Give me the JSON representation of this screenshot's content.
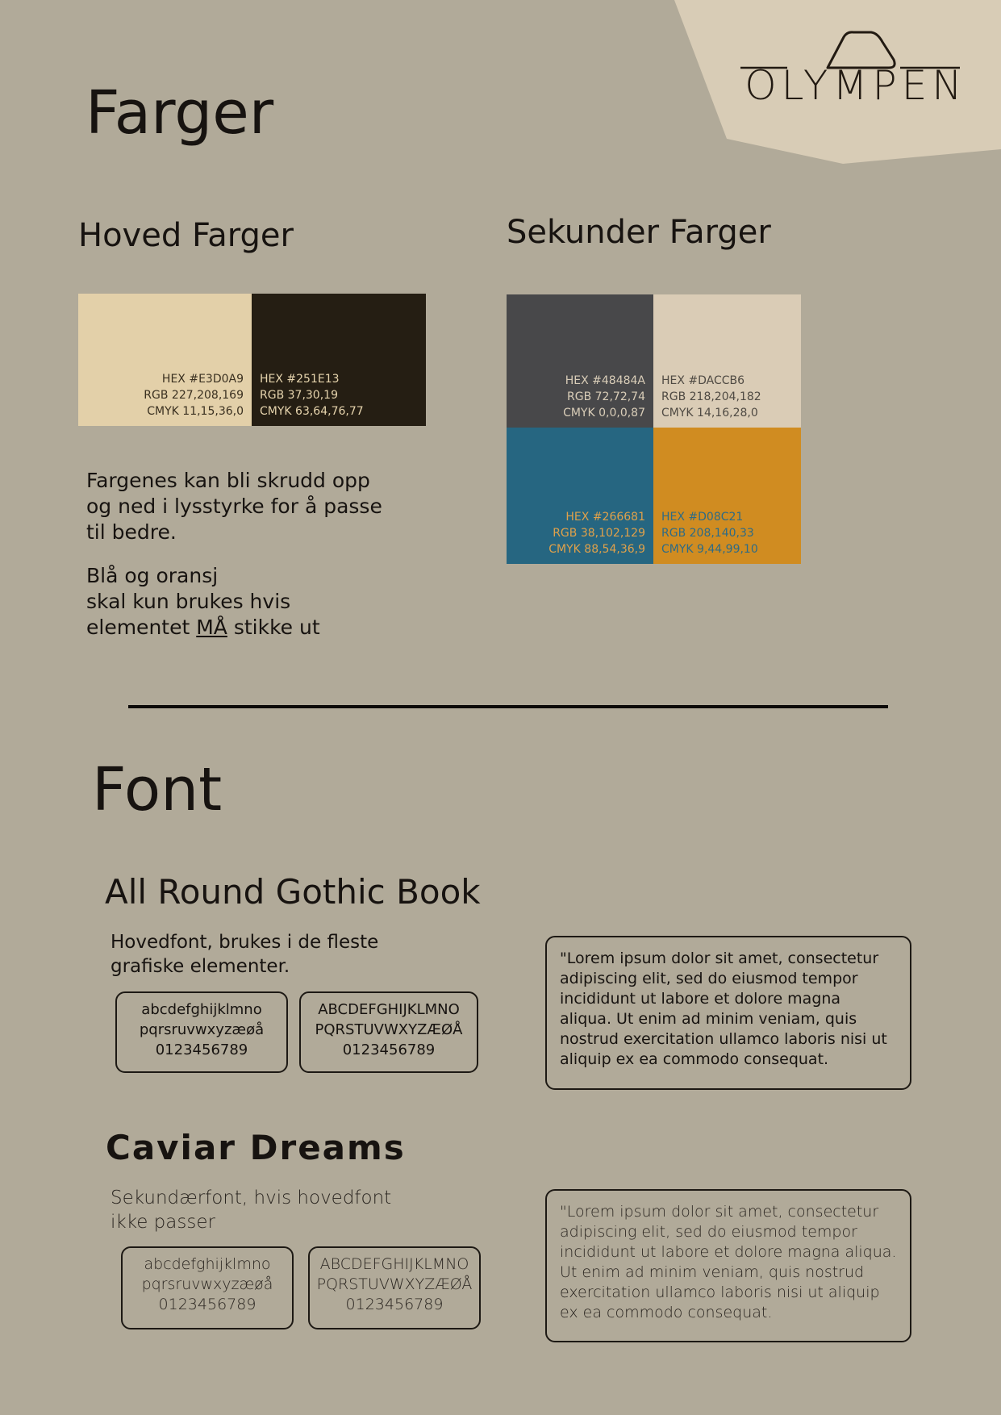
{
  "logo": {
    "text": "OLYMPEN"
  },
  "colors_section": {
    "title": "Farger"
  },
  "primary": {
    "title": "Hoved Farger",
    "swatches": [
      {
        "color": "#E3D0A9",
        "text_color": "#3a3020",
        "hex": "HEX #E3D0A9",
        "rgb": "RGB 227,208,169",
        "cmyk": "CMYK 11,15,36,0"
      },
      {
        "color": "#251E13",
        "text_color": "#e6d4ad",
        "hex": "HEX #251E13",
        "rgb": "RGB 37,30,19",
        "cmyk": "CMYK 63,64,76,77"
      }
    ],
    "note1": "Fargenes kan bli skrudd opp\nog ned i lysstyrke for å passe\ntil bedre.",
    "note2_line1": "Blå og oransj",
    "note2_line2": "skal kun brukes hvis",
    "note2_pre": "elementet ",
    "note2_emph": "MÅ",
    "note2_post": " stikke ut"
  },
  "secondary": {
    "title": "Sekunder Farger",
    "swatches": [
      {
        "color": "#48484A",
        "text_color": "#d9cdb8",
        "hex": "HEX #48484A",
        "rgb": "RGB 72,72,74",
        "cmyk": "CMYK 0,0,0,87"
      },
      {
        "color": "#DACCB6",
        "text_color": "#4f4a43",
        "hex": "HEX #DACCB6",
        "rgb": "RGB 218,204,182",
        "cmyk": "CMYK 14,16,28,0"
      },
      {
        "color": "#266681",
        "text_color": "#e0a14a",
        "hex": "HEX #266681",
        "rgb": "RGB 38,102,129",
        "cmyk": "CMYK 88,54,36,9"
      },
      {
        "color": "#D08C21",
        "text_color": "#2d6b86",
        "hex": "HEX #D08C21",
        "rgb": "RGB 208,140,33",
        "cmyk": "CMYK 9,44,99,10"
      }
    ]
  },
  "font_section": {
    "title": "Font"
  },
  "font_main": {
    "name": "All Round Gothic Book",
    "description": "Hovedfont, brukes i de fleste\ngrafiske elementer.",
    "lowercase": "abcdefghijklmno\npqrsruvwxyzæøå\n0123456789",
    "uppercase": "ABCDEFGHIJKLMNO\nPQRSTUVWXYZÆØÅ\n0123456789",
    "sample": "\"Lorem ipsum dolor sit amet, consectetur adipiscing elit, sed do eiusmod tempor incididunt ut labore et dolore magna aliqua. Ut enim ad minim veniam, quis nostrud exercitation ullamco laboris nisi ut aliquip ex ea commodo consequat."
  },
  "font_secondary": {
    "name": "Caviar Dreams",
    "description": "Sekundærfont, hvis hovedfont\nikke passer",
    "lowercase": "abcdefghijklmno\npqrsruvwxyzæøå\n0123456789",
    "uppercase": "ABCDEFGHIJKLMNO\nPQRSTUVWXYZÆØÅ\n0123456789",
    "sample": "\"Lorem ipsum dolor sit amet, consectetur adipiscing elit, sed do eiusmod tempor incididunt ut labore et dolore magna aliqua. Ut enim ad minim veniam, quis nostrud exercitation ullamco laboris nisi ut aliquip ex ea commodo consequat."
  }
}
